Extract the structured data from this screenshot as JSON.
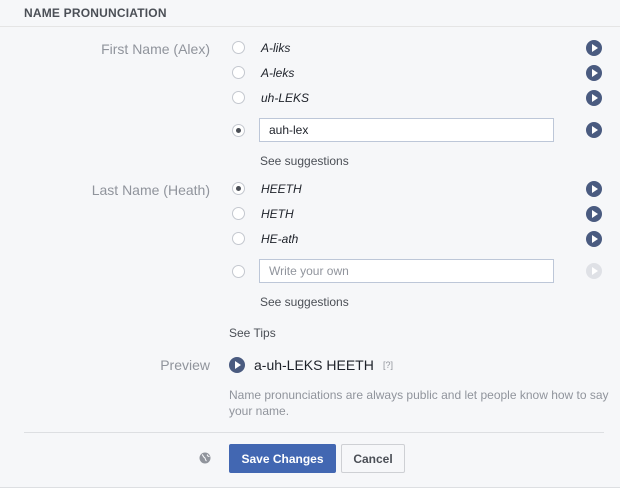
{
  "header": {
    "title": "NAME PRONUNCIATION"
  },
  "first_name": {
    "label": "First Name (Alex)",
    "options": [
      "A-liks",
      "A-leks",
      "uh-LEKS"
    ],
    "custom_value": "auh-lex",
    "see_suggestions": "See suggestions"
  },
  "last_name": {
    "label": "Last Name (Heath)",
    "options": [
      "HEETH",
      "HETH",
      "HE-ath"
    ],
    "custom_placeholder": "Write your own",
    "see_suggestions": "See suggestions"
  },
  "see_tips": "See Tips",
  "preview": {
    "label": "Preview",
    "text": "a-uh-LEKS HEETH",
    "help": "[?]"
  },
  "note": "Name pronunciations are always public and let people know how to say your name.",
  "buttons": {
    "save": "Save Changes",
    "cancel": "Cancel"
  },
  "colors": {
    "accent": "#4267b2",
    "play": "#4a5b80"
  }
}
